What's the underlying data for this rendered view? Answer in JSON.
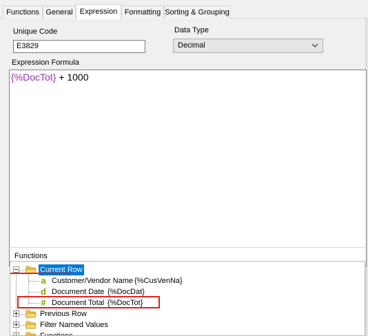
{
  "tabs": [
    "Functions",
    "General",
    "Expression",
    "Formatting",
    "Sorting & Grouping"
  ],
  "active_tab": "Expression",
  "unique_code": {
    "label": "Unique Code",
    "value": "E3829"
  },
  "data_type": {
    "label": "Data Type",
    "value": "Decimal"
  },
  "expression": {
    "label": "Expression Formula",
    "token": "{%DocTot}",
    "rest": " + 1000"
  },
  "functions": {
    "label": "Functions",
    "tree": {
      "current_row": "Current Row",
      "items": [
        {
          "type": "a",
          "name": "Customer/Vendor Name",
          "code": "{%CusVenNa}"
        },
        {
          "type": "d",
          "name": "Document Date",
          "code": "{%DocDat}"
        },
        {
          "type": "#",
          "name": "Document Total",
          "code": "{%DocTot}"
        }
      ],
      "previous_row": "Previous Row",
      "filter_named_values": "Filter Named Values",
      "functions_node": "Functions"
    }
  },
  "colors": {
    "selection": "#0078d7",
    "highlight_red": "#e02020",
    "token_purple": "#9b2fae",
    "type_glyph_green": "#7aa800"
  },
  "icons": [
    "folder-icon",
    "chevron-down-icon",
    "expand-icon",
    "collapse-icon",
    "text-type-icon",
    "date-type-icon",
    "number-type-icon"
  ]
}
